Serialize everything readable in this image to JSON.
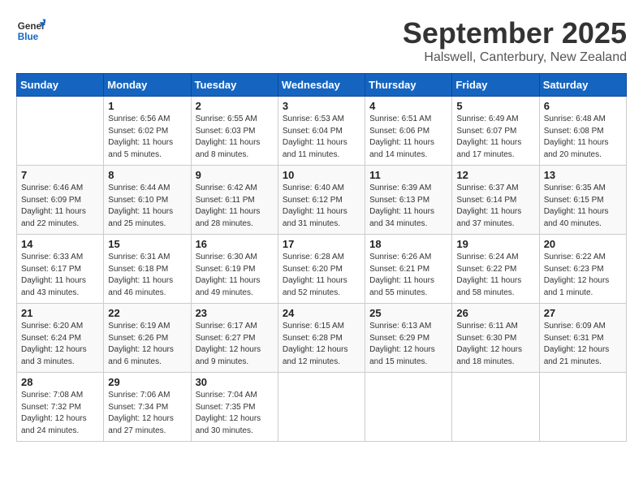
{
  "logo": {
    "line1": "General",
    "line2": "Blue"
  },
  "title": "September 2025",
  "subtitle": "Halswell, Canterbury, New Zealand",
  "days_header": [
    "Sunday",
    "Monday",
    "Tuesday",
    "Wednesday",
    "Thursday",
    "Friday",
    "Saturday"
  ],
  "weeks": [
    [
      {
        "day": "",
        "sunrise": "",
        "sunset": "",
        "daylight": ""
      },
      {
        "day": "1",
        "sunrise": "Sunrise: 6:56 AM",
        "sunset": "Sunset: 6:02 PM",
        "daylight": "Daylight: 11 hours and 5 minutes."
      },
      {
        "day": "2",
        "sunrise": "Sunrise: 6:55 AM",
        "sunset": "Sunset: 6:03 PM",
        "daylight": "Daylight: 11 hours and 8 minutes."
      },
      {
        "day": "3",
        "sunrise": "Sunrise: 6:53 AM",
        "sunset": "Sunset: 6:04 PM",
        "daylight": "Daylight: 11 hours and 11 minutes."
      },
      {
        "day": "4",
        "sunrise": "Sunrise: 6:51 AM",
        "sunset": "Sunset: 6:06 PM",
        "daylight": "Daylight: 11 hours and 14 minutes."
      },
      {
        "day": "5",
        "sunrise": "Sunrise: 6:49 AM",
        "sunset": "Sunset: 6:07 PM",
        "daylight": "Daylight: 11 hours and 17 minutes."
      },
      {
        "day": "6",
        "sunrise": "Sunrise: 6:48 AM",
        "sunset": "Sunset: 6:08 PM",
        "daylight": "Daylight: 11 hours and 20 minutes."
      }
    ],
    [
      {
        "day": "7",
        "sunrise": "Sunrise: 6:46 AM",
        "sunset": "Sunset: 6:09 PM",
        "daylight": "Daylight: 11 hours and 22 minutes."
      },
      {
        "day": "8",
        "sunrise": "Sunrise: 6:44 AM",
        "sunset": "Sunset: 6:10 PM",
        "daylight": "Daylight: 11 hours and 25 minutes."
      },
      {
        "day": "9",
        "sunrise": "Sunrise: 6:42 AM",
        "sunset": "Sunset: 6:11 PM",
        "daylight": "Daylight: 11 hours and 28 minutes."
      },
      {
        "day": "10",
        "sunrise": "Sunrise: 6:40 AM",
        "sunset": "Sunset: 6:12 PM",
        "daylight": "Daylight: 11 hours and 31 minutes."
      },
      {
        "day": "11",
        "sunrise": "Sunrise: 6:39 AM",
        "sunset": "Sunset: 6:13 PM",
        "daylight": "Daylight: 11 hours and 34 minutes."
      },
      {
        "day": "12",
        "sunrise": "Sunrise: 6:37 AM",
        "sunset": "Sunset: 6:14 PM",
        "daylight": "Daylight: 11 hours and 37 minutes."
      },
      {
        "day": "13",
        "sunrise": "Sunrise: 6:35 AM",
        "sunset": "Sunset: 6:15 PM",
        "daylight": "Daylight: 11 hours and 40 minutes."
      }
    ],
    [
      {
        "day": "14",
        "sunrise": "Sunrise: 6:33 AM",
        "sunset": "Sunset: 6:17 PM",
        "daylight": "Daylight: 11 hours and 43 minutes."
      },
      {
        "day": "15",
        "sunrise": "Sunrise: 6:31 AM",
        "sunset": "Sunset: 6:18 PM",
        "daylight": "Daylight: 11 hours and 46 minutes."
      },
      {
        "day": "16",
        "sunrise": "Sunrise: 6:30 AM",
        "sunset": "Sunset: 6:19 PM",
        "daylight": "Daylight: 11 hours and 49 minutes."
      },
      {
        "day": "17",
        "sunrise": "Sunrise: 6:28 AM",
        "sunset": "Sunset: 6:20 PM",
        "daylight": "Daylight: 11 hours and 52 minutes."
      },
      {
        "day": "18",
        "sunrise": "Sunrise: 6:26 AM",
        "sunset": "Sunset: 6:21 PM",
        "daylight": "Daylight: 11 hours and 55 minutes."
      },
      {
        "day": "19",
        "sunrise": "Sunrise: 6:24 AM",
        "sunset": "Sunset: 6:22 PM",
        "daylight": "Daylight: 11 hours and 58 minutes."
      },
      {
        "day": "20",
        "sunrise": "Sunrise: 6:22 AM",
        "sunset": "Sunset: 6:23 PM",
        "daylight": "Daylight: 12 hours and 1 minute."
      }
    ],
    [
      {
        "day": "21",
        "sunrise": "Sunrise: 6:20 AM",
        "sunset": "Sunset: 6:24 PM",
        "daylight": "Daylight: 12 hours and 3 minutes."
      },
      {
        "day": "22",
        "sunrise": "Sunrise: 6:19 AM",
        "sunset": "Sunset: 6:26 PM",
        "daylight": "Daylight: 12 hours and 6 minutes."
      },
      {
        "day": "23",
        "sunrise": "Sunrise: 6:17 AM",
        "sunset": "Sunset: 6:27 PM",
        "daylight": "Daylight: 12 hours and 9 minutes."
      },
      {
        "day": "24",
        "sunrise": "Sunrise: 6:15 AM",
        "sunset": "Sunset: 6:28 PM",
        "daylight": "Daylight: 12 hours and 12 minutes."
      },
      {
        "day": "25",
        "sunrise": "Sunrise: 6:13 AM",
        "sunset": "Sunset: 6:29 PM",
        "daylight": "Daylight: 12 hours and 15 minutes."
      },
      {
        "day": "26",
        "sunrise": "Sunrise: 6:11 AM",
        "sunset": "Sunset: 6:30 PM",
        "daylight": "Daylight: 12 hours and 18 minutes."
      },
      {
        "day": "27",
        "sunrise": "Sunrise: 6:09 AM",
        "sunset": "Sunset: 6:31 PM",
        "daylight": "Daylight: 12 hours and 21 minutes."
      }
    ],
    [
      {
        "day": "28",
        "sunrise": "Sunrise: 7:08 AM",
        "sunset": "Sunset: 7:32 PM",
        "daylight": "Daylight: 12 hours and 24 minutes."
      },
      {
        "day": "29",
        "sunrise": "Sunrise: 7:06 AM",
        "sunset": "Sunset: 7:34 PM",
        "daylight": "Daylight: 12 hours and 27 minutes."
      },
      {
        "day": "30",
        "sunrise": "Sunrise: 7:04 AM",
        "sunset": "Sunset: 7:35 PM",
        "daylight": "Daylight: 12 hours and 30 minutes."
      },
      {
        "day": "",
        "sunrise": "",
        "sunset": "",
        "daylight": ""
      },
      {
        "day": "",
        "sunrise": "",
        "sunset": "",
        "daylight": ""
      },
      {
        "day": "",
        "sunrise": "",
        "sunset": "",
        "daylight": ""
      },
      {
        "day": "",
        "sunrise": "",
        "sunset": "",
        "daylight": ""
      }
    ]
  ]
}
